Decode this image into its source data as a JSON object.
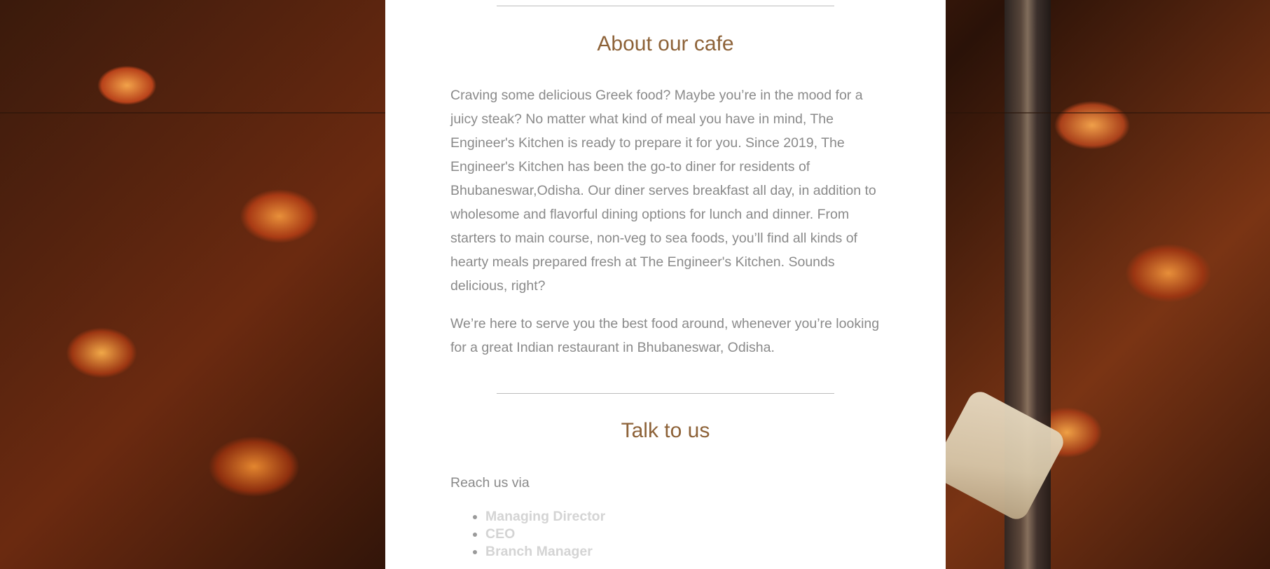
{
  "about": {
    "title": "About our cafe",
    "paragraph_1": "Craving some delicious Greek food? Maybe you’re in the mood for a juicy steak? No matter what kind of meal you have in mind, The Engineer's Kitchen is ready to prepare it for you. Since 2019, The Engineer's Kitchen has been the go-to diner for residents of Bhubaneswar,Odisha. Our diner serves breakfast all day, in addition to wholesome and flavorful dining options for lunch and dinner. From starters to main course, non-veg to sea foods, you’ll find all kinds of hearty meals prepared fresh at The Engineer's Kitchen. Sounds delicious, right?",
    "paragraph_2": "We’re here to serve you the best food around, whenever you’re looking for a great Indian restaurant in Bhubaneswar, Odisha."
  },
  "contact": {
    "title": "Talk to us",
    "intro": "Reach us via",
    "items": [
      "Managing Director",
      "CEO",
      "Branch Manager"
    ]
  },
  "colors": {
    "heading": "#8d6238",
    "body_text": "#8a8a8a",
    "link_text": "#d4d4d4",
    "panel_bg": "#ffffff"
  }
}
